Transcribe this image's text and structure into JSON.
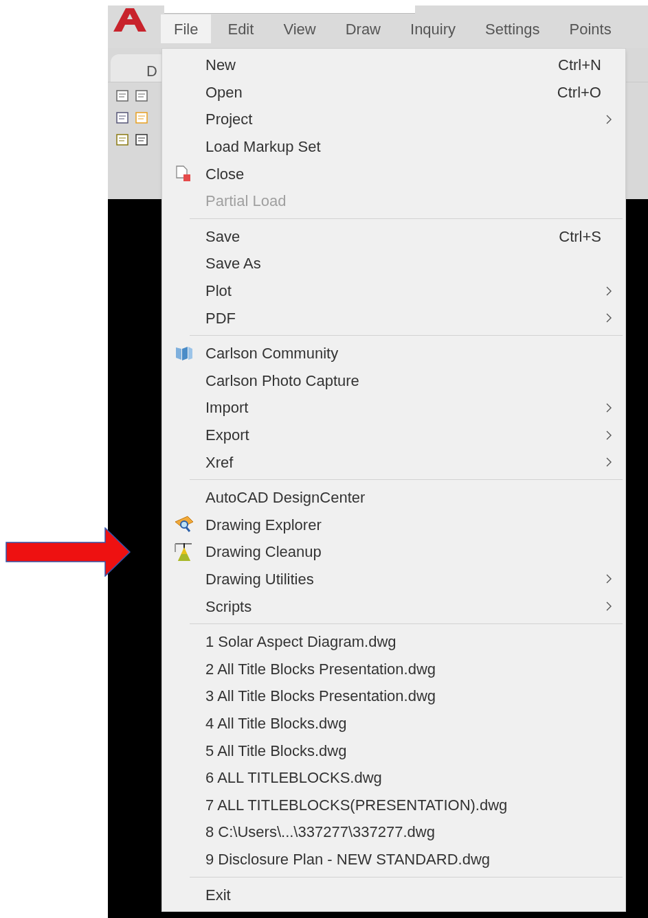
{
  "menubar": [
    {
      "label": "File",
      "selected": true
    },
    {
      "label": "Edit",
      "selected": false
    },
    {
      "label": "View",
      "selected": false
    },
    {
      "label": "Draw",
      "selected": false
    },
    {
      "label": "Inquiry",
      "selected": false
    },
    {
      "label": "Settings",
      "selected": false
    },
    {
      "label": "Points",
      "selected": false
    }
  ],
  "tab": {
    "label": "D"
  },
  "menu": [
    {
      "kind": "item",
      "label": "New",
      "shortcut": "Ctrl+N",
      "submenu": false,
      "disabled": false
    },
    {
      "kind": "item",
      "label": "Open",
      "shortcut": "Ctrl+O",
      "submenu": false,
      "disabled": false
    },
    {
      "kind": "item",
      "label": "Project",
      "submenu": true,
      "disabled": false
    },
    {
      "kind": "item",
      "label": "Load Markup Set",
      "submenu": false,
      "disabled": false
    },
    {
      "kind": "item",
      "label": "Close",
      "submenu": false,
      "disabled": false
    },
    {
      "kind": "item",
      "label": "Partial Load",
      "submenu": false,
      "disabled": true
    },
    {
      "kind": "separator"
    },
    {
      "kind": "item",
      "label": "Save",
      "shortcut": "Ctrl+S",
      "submenu": false,
      "disabled": false
    },
    {
      "kind": "item",
      "label": "Save As",
      "submenu": false,
      "disabled": false
    },
    {
      "kind": "item",
      "label": "Plot",
      "submenu": true,
      "disabled": false
    },
    {
      "kind": "item",
      "label": "PDF",
      "submenu": true,
      "disabled": false
    },
    {
      "kind": "separator"
    },
    {
      "kind": "item",
      "label": "Carlson Community",
      "submenu": false,
      "disabled": false
    },
    {
      "kind": "item",
      "label": "Carlson Photo Capture",
      "submenu": false,
      "disabled": false
    },
    {
      "kind": "item",
      "label": "Import",
      "submenu": true,
      "disabled": false
    },
    {
      "kind": "item",
      "label": "Export",
      "submenu": true,
      "disabled": false
    },
    {
      "kind": "item",
      "label": "Xref",
      "submenu": true,
      "disabled": false
    },
    {
      "kind": "separator"
    },
    {
      "kind": "item",
      "label": "AutoCAD DesignCenter",
      "submenu": false,
      "disabled": false
    },
    {
      "kind": "item",
      "label": "Drawing Explorer",
      "submenu": false,
      "disabled": false
    },
    {
      "kind": "item",
      "label": "Drawing Cleanup",
      "submenu": false,
      "disabled": false
    },
    {
      "kind": "item",
      "label": "Drawing Utilities",
      "submenu": true,
      "disabled": false
    },
    {
      "kind": "item",
      "label": "Scripts",
      "submenu": true,
      "disabled": false
    },
    {
      "kind": "separator"
    },
    {
      "kind": "item",
      "label": "1 Solar Aspect Diagram.dwg",
      "submenu": false,
      "disabled": false
    },
    {
      "kind": "item",
      "label": "2 All Title Blocks Presentation.dwg",
      "submenu": false,
      "disabled": false
    },
    {
      "kind": "item",
      "label": "3 All Title Blocks Presentation.dwg",
      "submenu": false,
      "disabled": false
    },
    {
      "kind": "item",
      "label": "4 All Title Blocks.dwg",
      "submenu": false,
      "disabled": false
    },
    {
      "kind": "item",
      "label": "5 All Title Blocks.dwg",
      "submenu": false,
      "disabled": false
    },
    {
      "kind": "item",
      "label": "6 ALL TITLEBLOCKS.dwg",
      "submenu": false,
      "disabled": false
    },
    {
      "kind": "item",
      "label": "7 ALL TITLEBLOCKS(PRESENTATION).dwg",
      "submenu": false,
      "disabled": false
    },
    {
      "kind": "item",
      "label": "8 C:\\Users\\...\\337277\\337277.dwg",
      "submenu": false,
      "disabled": false
    },
    {
      "kind": "item",
      "label": "9 Disclosure Plan - NEW STANDARD.dwg",
      "submenu": false,
      "disabled": false
    },
    {
      "kind": "separator"
    },
    {
      "kind": "item",
      "label": "Exit",
      "submenu": false,
      "disabled": false
    }
  ]
}
